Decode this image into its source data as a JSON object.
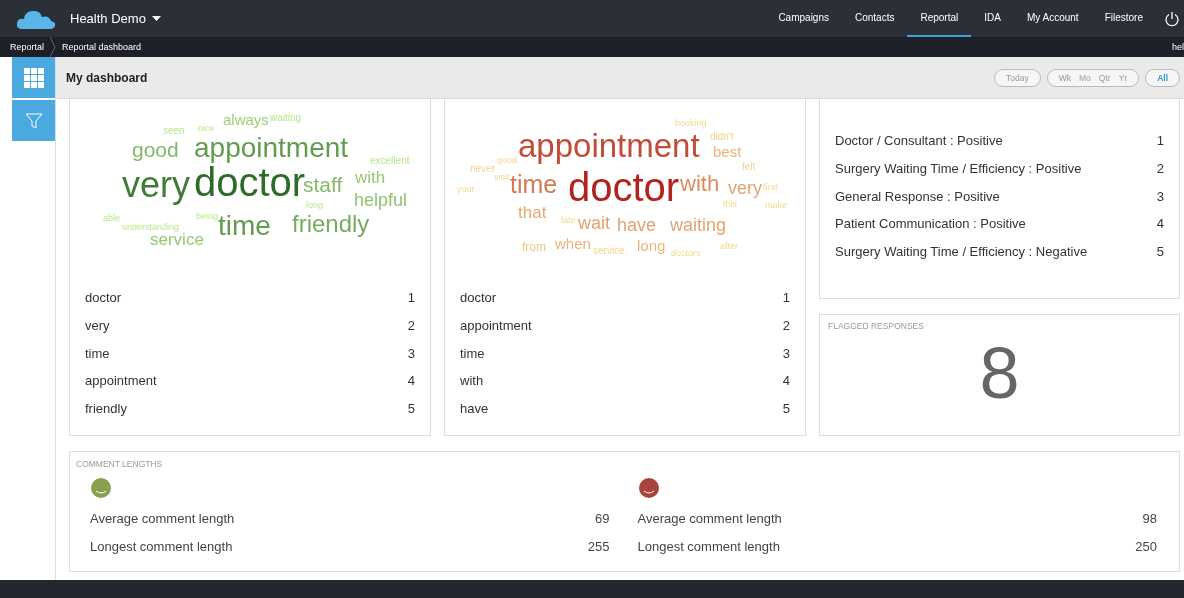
{
  "header": {
    "app_title": "Health Demo",
    "nav": [
      {
        "label": "Campaigns",
        "selected": false
      },
      {
        "label": "Contacts",
        "selected": false
      },
      {
        "label": "Reportal",
        "selected": true
      },
      {
        "label": "IDA",
        "selected": false
      },
      {
        "label": "My Account",
        "selected": false
      },
      {
        "label": "Filestore",
        "selected": false
      }
    ]
  },
  "breadcrumb": {
    "items": [
      "Reportal",
      "Reportal dashboard"
    ],
    "user": "hel"
  },
  "toolbar": {
    "title": "My dashboard",
    "ranges": [
      [
        {
          "label": "Today",
          "selected": false
        }
      ],
      [
        {
          "label": "Wk",
          "selected": false
        },
        {
          "label": "Mo",
          "selected": false
        },
        {
          "label": "Qtr",
          "selected": false
        },
        {
          "label": "Yr",
          "selected": false
        }
      ],
      [
        {
          "label": "All",
          "selected": true
        }
      ]
    ]
  },
  "word_panels": [
    {
      "kind": "positive",
      "cloud": [
        "seen",
        "nice",
        "always",
        "waiting",
        "good",
        "appointment",
        "excellent",
        "very",
        "doctor",
        "staff",
        "with",
        "long",
        "helpful",
        "able",
        "understanding",
        "being",
        "time",
        "friendly",
        "service"
      ],
      "ranks": [
        {
          "word": "doctor",
          "rank": "1"
        },
        {
          "word": "very",
          "rank": "2"
        },
        {
          "word": "time",
          "rank": "3"
        },
        {
          "word": "appointment",
          "rank": "4"
        },
        {
          "word": "friendly",
          "rank": "5"
        }
      ]
    },
    {
      "kind": "negative",
      "cloud": [
        "booking",
        "didn't",
        "good",
        "appointment",
        "best",
        "felt",
        "your",
        "never",
        "visit",
        "time",
        "doctor",
        "with",
        "very",
        "first",
        "that",
        "late",
        "wait",
        "have",
        "waiting",
        "this",
        "make",
        "from",
        "when",
        "service",
        "long",
        "doctors",
        "after"
      ],
      "ranks": [
        {
          "word": "doctor",
          "rank": "1"
        },
        {
          "word": "appointment",
          "rank": "2"
        },
        {
          "word": "time",
          "rank": "3"
        },
        {
          "word": "with",
          "rank": "4"
        },
        {
          "word": "have",
          "rank": "5"
        }
      ]
    }
  ],
  "categories": [
    {
      "label": "Doctor / Consultant : Positive",
      "rank": "1"
    },
    {
      "label": "Surgery Waiting Time / Efficiency : Positive",
      "rank": "2"
    },
    {
      "label": "General Response : Positive",
      "rank": "3"
    },
    {
      "label": "Patient Communication : Positive",
      "rank": "4"
    },
    {
      "label": "Surgery Waiting Time / Efficiency : Negative",
      "rank": "5"
    }
  ],
  "flagged": {
    "title": "FLAGGED RESPONSES",
    "count": "8"
  },
  "comment_lengths": {
    "title": "COMMENT LENGTHS",
    "groups": [
      {
        "color": "#8aa04e",
        "rows": [
          {
            "label": "Average comment length",
            "value": "69"
          },
          {
            "label": "Longest comment length",
            "value": "255"
          }
        ]
      },
      {
        "color": "#a8453a",
        "rows": [
          {
            "label": "Average comment length",
            "value": "98"
          },
          {
            "label": "Longest comment length",
            "value": "250"
          }
        ]
      }
    ]
  }
}
